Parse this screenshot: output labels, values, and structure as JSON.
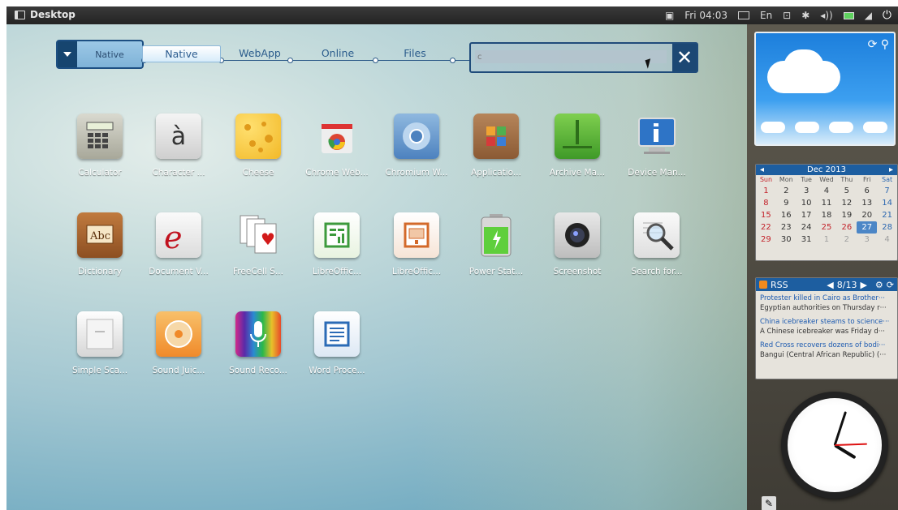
{
  "topbar": {
    "desktop_label": "Desktop",
    "datetime": "Fri 04:03",
    "language": "En"
  },
  "launcher": {
    "dropdown_label": "Native",
    "tabs": [
      {
        "label": "Native",
        "active": true
      },
      {
        "label": "WebApp",
        "active": false
      },
      {
        "label": "Online",
        "active": false
      },
      {
        "label": "Files",
        "active": false
      }
    ],
    "search_value": "c"
  },
  "apps": [
    {
      "name": "Calculator",
      "icon": "calculator-icon"
    },
    {
      "name": "Character ...",
      "icon": "character-map-icon"
    },
    {
      "name": "Cheese",
      "icon": "cheese-icon"
    },
    {
      "name": "Chrome Web...",
      "icon": "chrome-web-store-icon"
    },
    {
      "name": "Chromium W...",
      "icon": "chromium-icon"
    },
    {
      "name": "Applicatio...",
      "icon": "application-box-icon"
    },
    {
      "name": "Archive Ma...",
      "icon": "archive-manager-icon"
    },
    {
      "name": "Device Man...",
      "icon": "device-manager-icon"
    },
    {
      "name": "Dictionary",
      "icon": "dictionary-icon"
    },
    {
      "name": "Document V...",
      "icon": "document-viewer-icon"
    },
    {
      "name": "FreeCell S...",
      "icon": "freecell-icon"
    },
    {
      "name": "LibreOffic...",
      "icon": "libreoffice-calc-icon"
    },
    {
      "name": "LibreOffic...",
      "icon": "libreoffice-impress-icon"
    },
    {
      "name": "Power Stat...",
      "icon": "power-statistics-icon"
    },
    {
      "name": "Screenshot",
      "icon": "screenshot-icon"
    },
    {
      "name": "Search for...",
      "icon": "search-files-icon"
    },
    {
      "name": "Simple Sca...",
      "icon": "simple-scan-icon"
    },
    {
      "name": "Sound Juic...",
      "icon": "sound-juicer-icon"
    },
    {
      "name": "Sound Reco...",
      "icon": "sound-recorder-icon"
    },
    {
      "name": "Word Proce...",
      "icon": "word-processor-icon"
    }
  ],
  "calendar": {
    "month": "Dec 2013",
    "days_header": [
      "Sun",
      "Mon",
      "Tue",
      "Wed",
      "Thu",
      "Fri",
      "Sat"
    ],
    "weeks": [
      [
        "1",
        "2",
        "3",
        "4",
        "5",
        "6",
        "7"
      ],
      [
        "8",
        "9",
        "10",
        "11",
        "12",
        "13",
        "14"
      ],
      [
        "15",
        "16",
        "17",
        "18",
        "19",
        "20",
        "21"
      ],
      [
        "22",
        "23",
        "24",
        "25",
        "26",
        "27",
        "28"
      ],
      [
        "29",
        "30",
        "31",
        "1",
        "2",
        "3",
        "4"
      ]
    ],
    "today": "27"
  },
  "rss": {
    "title": "RSS",
    "pager": "8/13",
    "items": [
      {
        "title": "Protester killed in Cairo as Brother···",
        "desc": "Egyptian authorities on Thursday r···"
      },
      {
        "title": "China icebreaker steams to science···",
        "desc": "A Chinese icebreaker was Friday d···"
      },
      {
        "title": "Red Cross recovers dozens of bodi···",
        "desc": "Bangui (Central African Republic) (···"
      }
    ]
  },
  "clock": {
    "hours": 4,
    "minutes": 3
  },
  "colors": {
    "accent": "#1d5ea0",
    "dark_panel": "#242424"
  }
}
